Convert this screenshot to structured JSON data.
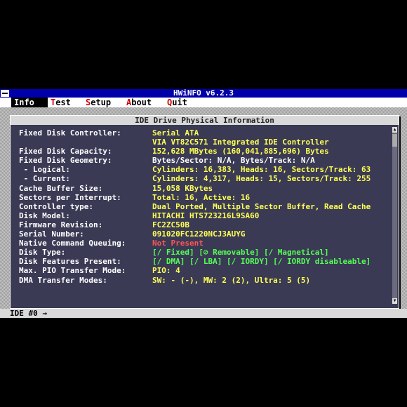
{
  "app": {
    "title": "HWiNFO v6.2.3"
  },
  "menu": [
    {
      "hot": "I",
      "rest": "nfo",
      "active": true
    },
    {
      "hot": "T",
      "rest": "est",
      "active": false
    },
    {
      "hot": "S",
      "rest": "etup",
      "active": false
    },
    {
      "hot": "A",
      "rest": "bout",
      "active": false
    },
    {
      "hot": "Q",
      "rest": "uit",
      "active": false
    }
  ],
  "dialog": {
    "title": "IDE Drive Physical Information"
  },
  "rows": {
    "controller": {
      "label": "Fixed Disk Controller:",
      "value": "Serial ATA"
    },
    "controller_name": {
      "value": "VIA VT82C571 Integrated IDE Controller"
    },
    "capacity": {
      "label": "Fixed Disk Capacity:",
      "value": "152,628 MBytes (160,041,885,696) Bytes"
    },
    "geometry": {
      "label": "Fixed Disk Geometry:",
      "value": "Bytes/Sector: N/A, Bytes/Track: N/A"
    },
    "logical": {
      "label": " - Logical:",
      "value": "Cylinders: 16,383, Heads: 16, Sectors/Track: 63"
    },
    "current": {
      "label": " - Current:",
      "value": "Cylinders: 4,317, Heads: 15, Sectors/Track: 255"
    },
    "cache": {
      "label": "Cache Buffer Size:",
      "value": "15,058 KBytes"
    },
    "sectors_interrupt": {
      "label": "Sectors per Interrupt:",
      "value": "Total: 16, Active: 16"
    },
    "controller_type": {
      "label": "Controller type:",
      "value": "Dual Ported, Multiple Sector Buffer, Read Cache"
    },
    "model": {
      "label": "Disk Model:",
      "value": "HITACHI HTS723216L9SA60"
    },
    "firmware": {
      "label": "Firmware Revision:",
      "value": "FC2ZC50B"
    },
    "serial": {
      "label": "Serial Number:",
      "value": "091020FC1220NCJ3AUYG"
    },
    "ncq": {
      "label": "Native Command Queuing:",
      "value": "Not Present"
    },
    "disk_type": {
      "label": "Disk Type:",
      "value": "[/ Fixed] [⊘ Removable] [/ Magnetical]"
    },
    "features": {
      "label": "Disk Features Present:",
      "value": "[/ DMA] [/ LBA] [/ IORDY] [/ IORDY disableable]"
    },
    "pio": {
      "label": "Max. PIO Transfer Mode:",
      "value": "PIO: 4"
    },
    "dma": {
      "label": "DMA Transfer Modes:",
      "value": "SW: - (-), MW: 2 (2), Ultra: 5 (5)"
    }
  },
  "status": {
    "text": "IDE #0 →"
  },
  "colors": {
    "titlebar": "#0000aa",
    "dialog_bg": "#3a3a55",
    "value_yellow": "#ffff55",
    "value_red": "#ff5555",
    "value_green": "#55ff55"
  }
}
